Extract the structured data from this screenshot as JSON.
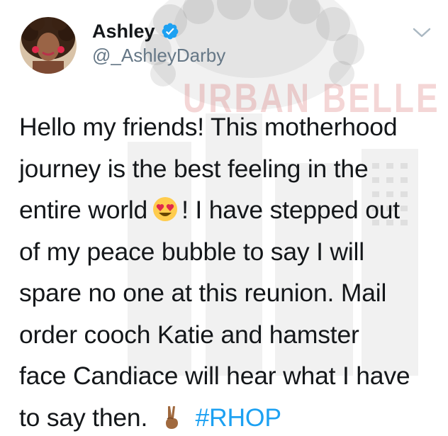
{
  "author": {
    "display_name": "Ashley",
    "handle": "@_AshleyDarby",
    "verified": true
  },
  "watermark": {
    "text": "URBAN BELLE"
  },
  "tweet": {
    "lines": [
      "Hello my friends! This motherhood",
      "journey is the best feeling in the",
      "entire world",
      "! I have stepped out",
      "of my peace bubble to say I will",
      "spare no one at this reunion. Mail",
      "order cooch Katie and hamster",
      "face Candiace will hear what I have",
      "to say then."
    ],
    "hashtag": "#RHOP",
    "emojis": [
      "heart-eyes-emoji",
      "victory-hand-emoji"
    ]
  },
  "colors": {
    "text": "#14171a",
    "secondary": "#657786",
    "link": "#1da1f2",
    "verified": "#1da1f2"
  }
}
